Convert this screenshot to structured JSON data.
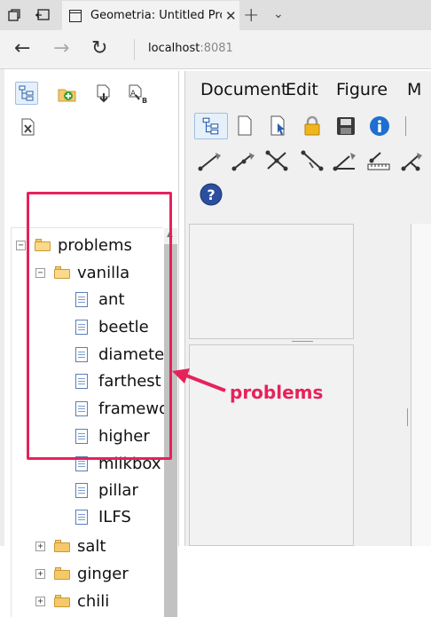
{
  "browser": {
    "tab_title": "Geometria: Untitled Pro",
    "tab_close": "✕",
    "new_tab": "+",
    "tab_menu": "⌄",
    "address_host": "localhost",
    "address_port": ":8081",
    "back": "←",
    "forward": "→",
    "reload": "↻"
  },
  "menu": {
    "items": [
      "Document",
      "Edit",
      "Figure",
      "M"
    ]
  },
  "tree": {
    "root": {
      "label": "problems",
      "expander": "−"
    },
    "vanilla": {
      "label": "vanilla",
      "expander": "−"
    },
    "files": [
      "ant",
      "beetle",
      "diamete",
      "farthest",
      "framewo",
      "higher",
      "milkbox",
      "pillar",
      "ILFS"
    ],
    "folders": [
      {
        "label": "salt",
        "expander": "+"
      },
      {
        "label": "ginger",
        "expander": "+"
      },
      {
        "label": "chili",
        "expander": "+"
      }
    ]
  },
  "annotation": {
    "label": "problems",
    "color": "#e6225b"
  },
  "colors": {
    "accent": "#e6225b",
    "folder": "#f5c86a",
    "selection": "#e6f0fb"
  }
}
